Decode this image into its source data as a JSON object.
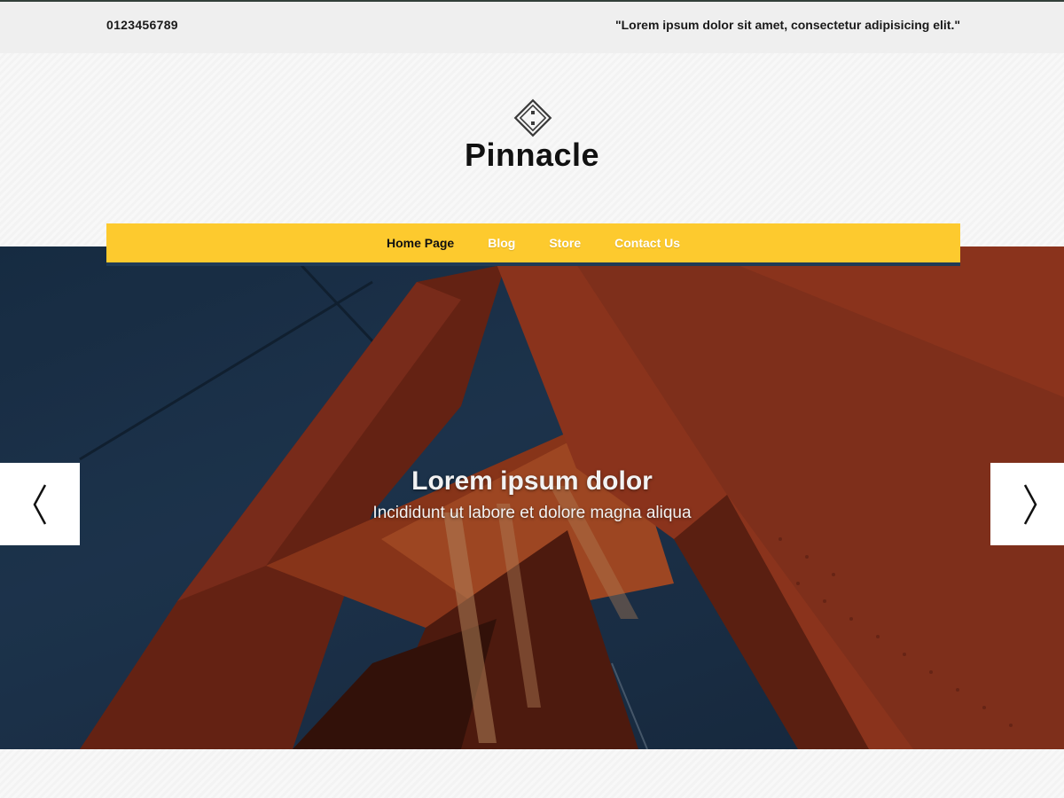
{
  "topbar": {
    "phone": "0123456789",
    "quote": "\"Lorem ipsum dolor sit amet, consectetur adipisicing elit.\""
  },
  "header": {
    "site_title": "Pinnacle",
    "logo_icon": "diamond-logo-icon"
  },
  "nav": {
    "items": [
      {
        "label": "Home Page",
        "active": true
      },
      {
        "label": "Blog",
        "active": false
      },
      {
        "label": "Store",
        "active": false
      },
      {
        "label": "Contact Us",
        "active": false
      }
    ]
  },
  "slider": {
    "caption_title": "Lorem ipsum dolor",
    "caption_subtitle": "Incididunt ut labore et dolore magna aliqua",
    "prev_icon": "chevron-left-icon",
    "next_icon": "chevron-right-icon"
  },
  "colors": {
    "nav_background": "#fdca2e",
    "topbar_background": "#efefef",
    "sky": "#1f3a56",
    "bridge": "#b5442a"
  }
}
